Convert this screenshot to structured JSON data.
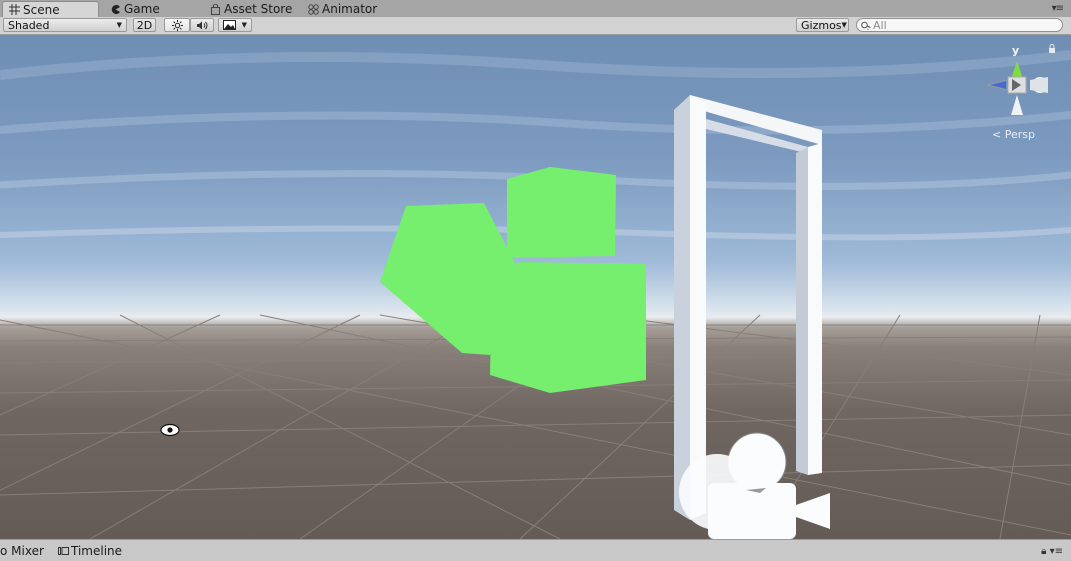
{
  "tabs": [
    {
      "label": "Scene",
      "icon": "grid-icon",
      "active": true
    },
    {
      "label": "Game",
      "icon": "pacman-icon",
      "active": false
    },
    {
      "label": "Asset Store",
      "icon": "store-icon",
      "active": false
    },
    {
      "label": "Animator",
      "icon": "animator-icon",
      "active": false
    }
  ],
  "toolbar": {
    "draw_mode": "Shaded",
    "mode_2d": "2D",
    "gizmos": "Gizmos",
    "search_placeholder": "All"
  },
  "gizmo": {
    "axis_y": "y",
    "projection": "Persp"
  },
  "bottom_tabs": [
    {
      "label": "o Mixer",
      "icon": null
    },
    {
      "label": "Timeline",
      "icon": "timeline-icon"
    }
  ],
  "colors": {
    "cube_green": "#76ee6e",
    "door_white": "#ffffff",
    "sky": "#7d9bc0",
    "ground": "#6b625d"
  }
}
